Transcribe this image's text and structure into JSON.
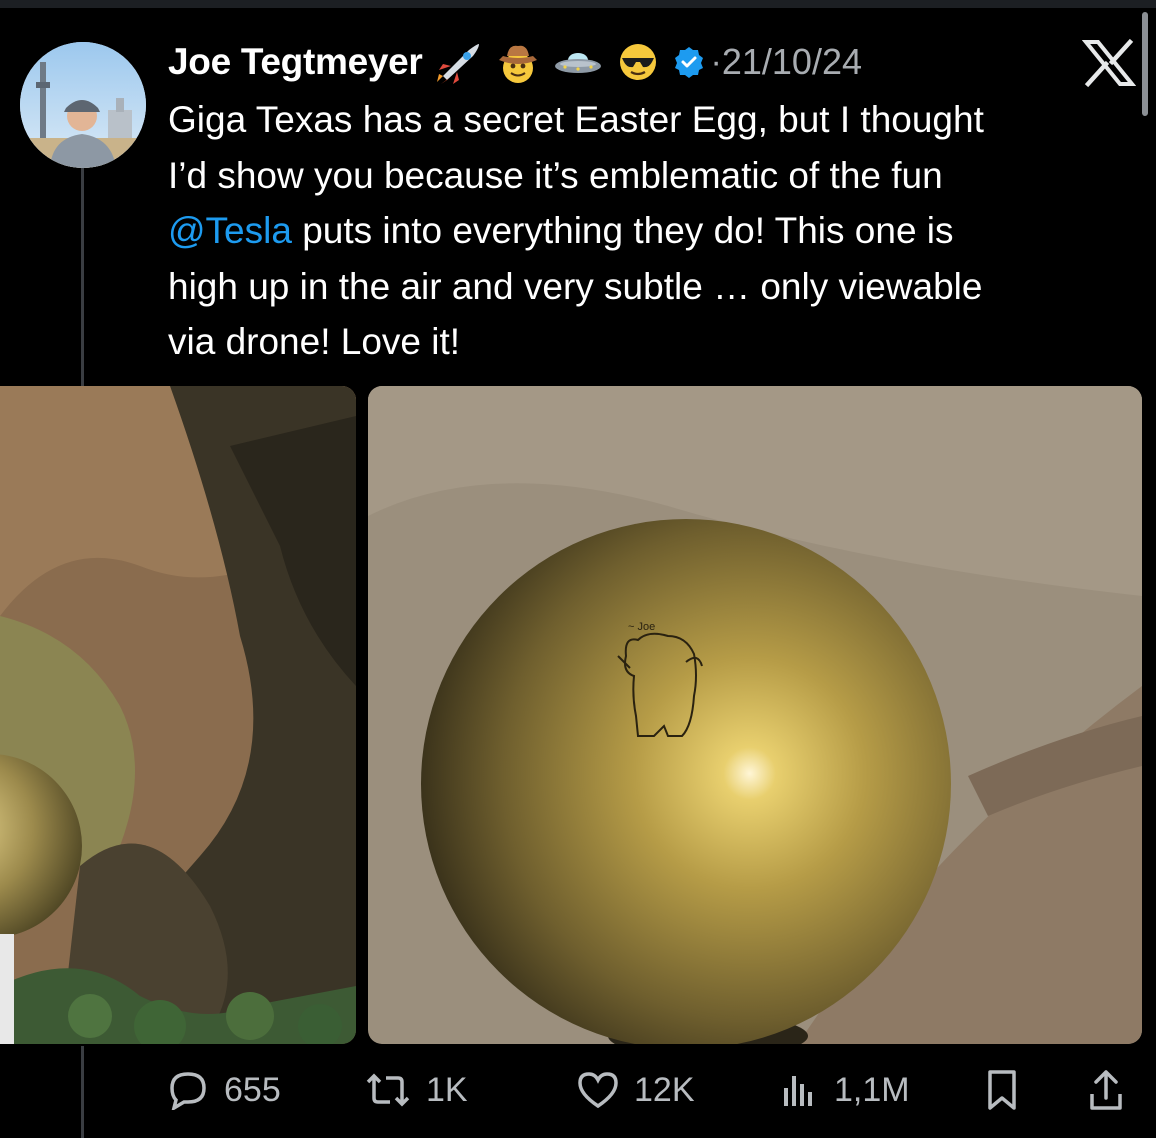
{
  "tweet": {
    "author": "Joe Tegtmeyer",
    "date": "21/10/24",
    "separator": "·",
    "text_before_mention": "Giga Texas has a secret Easter Egg, but I thought\nI’d show you because it’s emblematic of the fun\n",
    "mention": "@Tesla",
    "text_after_mention": " puts into everything they do! This one is\nhigh up in the air and very subtle … only viewable\nvia drone! Love it!"
  },
  "badges": [
    "rocket-icon",
    "cowboy-hat-face-icon",
    "flying-saucer-icon",
    "sunglasses-face-icon",
    "verified-badge-icon"
  ],
  "engraving_text": "~ Joe",
  "actions": {
    "replies": "655",
    "reposts": "1K",
    "likes": "12K",
    "views": "1,1M"
  },
  "colors": {
    "background": "#000000",
    "text": "#ffffff",
    "secondary": "#a8acb1",
    "accent": "#1d9bf0"
  }
}
